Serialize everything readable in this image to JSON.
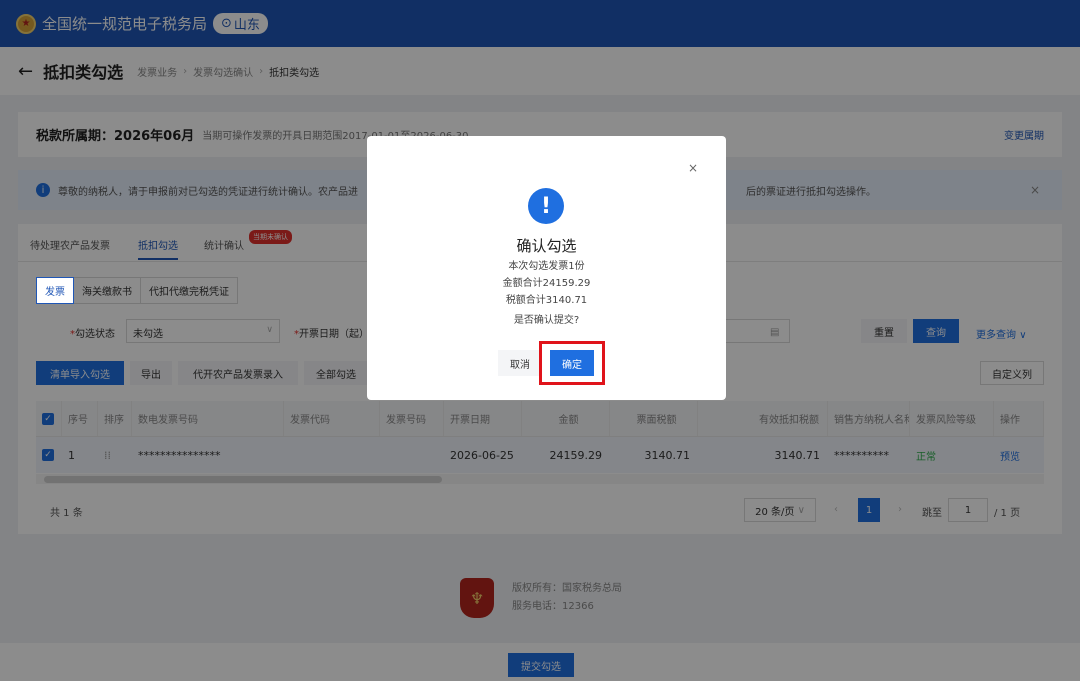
{
  "header": {
    "site_title": "全国统一规范电子税务局",
    "location": "山东",
    "emblem_icon": "national-tax-emblem",
    "accent": "#1f56b6"
  },
  "titlebar": {
    "title": "抵扣类勾选",
    "breadcrumb": [
      "发票业务",
      "发票勾选确认",
      "抵扣类勾选"
    ]
  },
  "period": {
    "label": "税款所属期：2026年06月",
    "hint": "当期可操作发票的开具日期范围2017-01-01至2026-06-30",
    "change_link": "变更属期"
  },
  "notice": {
    "text_left": "尊敬的纳税人，请于申报前对已勾选的凭证进行统计确认。农产品进",
    "text_right": "后的票证进行抵扣勾选操作。"
  },
  "tabs": {
    "items": [
      "待处理农产品发票",
      "抵扣勾选",
      "统计确认"
    ],
    "badge": "当期未确认"
  },
  "subtabs": [
    "发票",
    "海关缴款书",
    "代扣代缴完税凭证"
  ],
  "filters": {
    "status_label": "勾选状态",
    "status_value": "未勾选",
    "date_label": "开票日期（起）",
    "reset": "重置",
    "query": "查询",
    "more": "更多查询"
  },
  "actions": {
    "import": "清单导入勾选",
    "export": "导出",
    "agri": "代开农产品发票录入",
    "select_all": "全部勾选",
    "custom_cols": "自定义列"
  },
  "table": {
    "headers": [
      "序号",
      "排序",
      "数电发票号码",
      "发票代码",
      "发票号码",
      "开票日期",
      "金额",
      "票面税额",
      "有效抵扣税额",
      "销售方纳税人名称",
      "发票风险等级",
      "操作"
    ],
    "rows": [
      {
        "index": "1",
        "invoice_no": "***************",
        "date": "2026-06-25",
        "amount": "24159.29",
        "tax": "3140.71",
        "valid_tax": "3140.71",
        "seller": "**********",
        "risk": "正常",
        "action": "预览"
      }
    ]
  },
  "pagination": {
    "total": "共 1 条",
    "page_size": "20 条/页",
    "current": "1",
    "jump_label": "跳至",
    "jump_value": "1",
    "pages": "/ 1 页"
  },
  "footer": {
    "copyright": "版权所有：国家税务总局",
    "phone": "服务电话：12366"
  },
  "bottom": {
    "submit": "提交勾选"
  },
  "modal": {
    "title": "确认勾选",
    "lines": [
      "本次勾选发票1份",
      "金额合计24159.29",
      "税额合计3140.71"
    ],
    "question": "是否确认提交?",
    "cancel": "取消",
    "confirm": "确定",
    "highlight_color": "#e0131a"
  }
}
